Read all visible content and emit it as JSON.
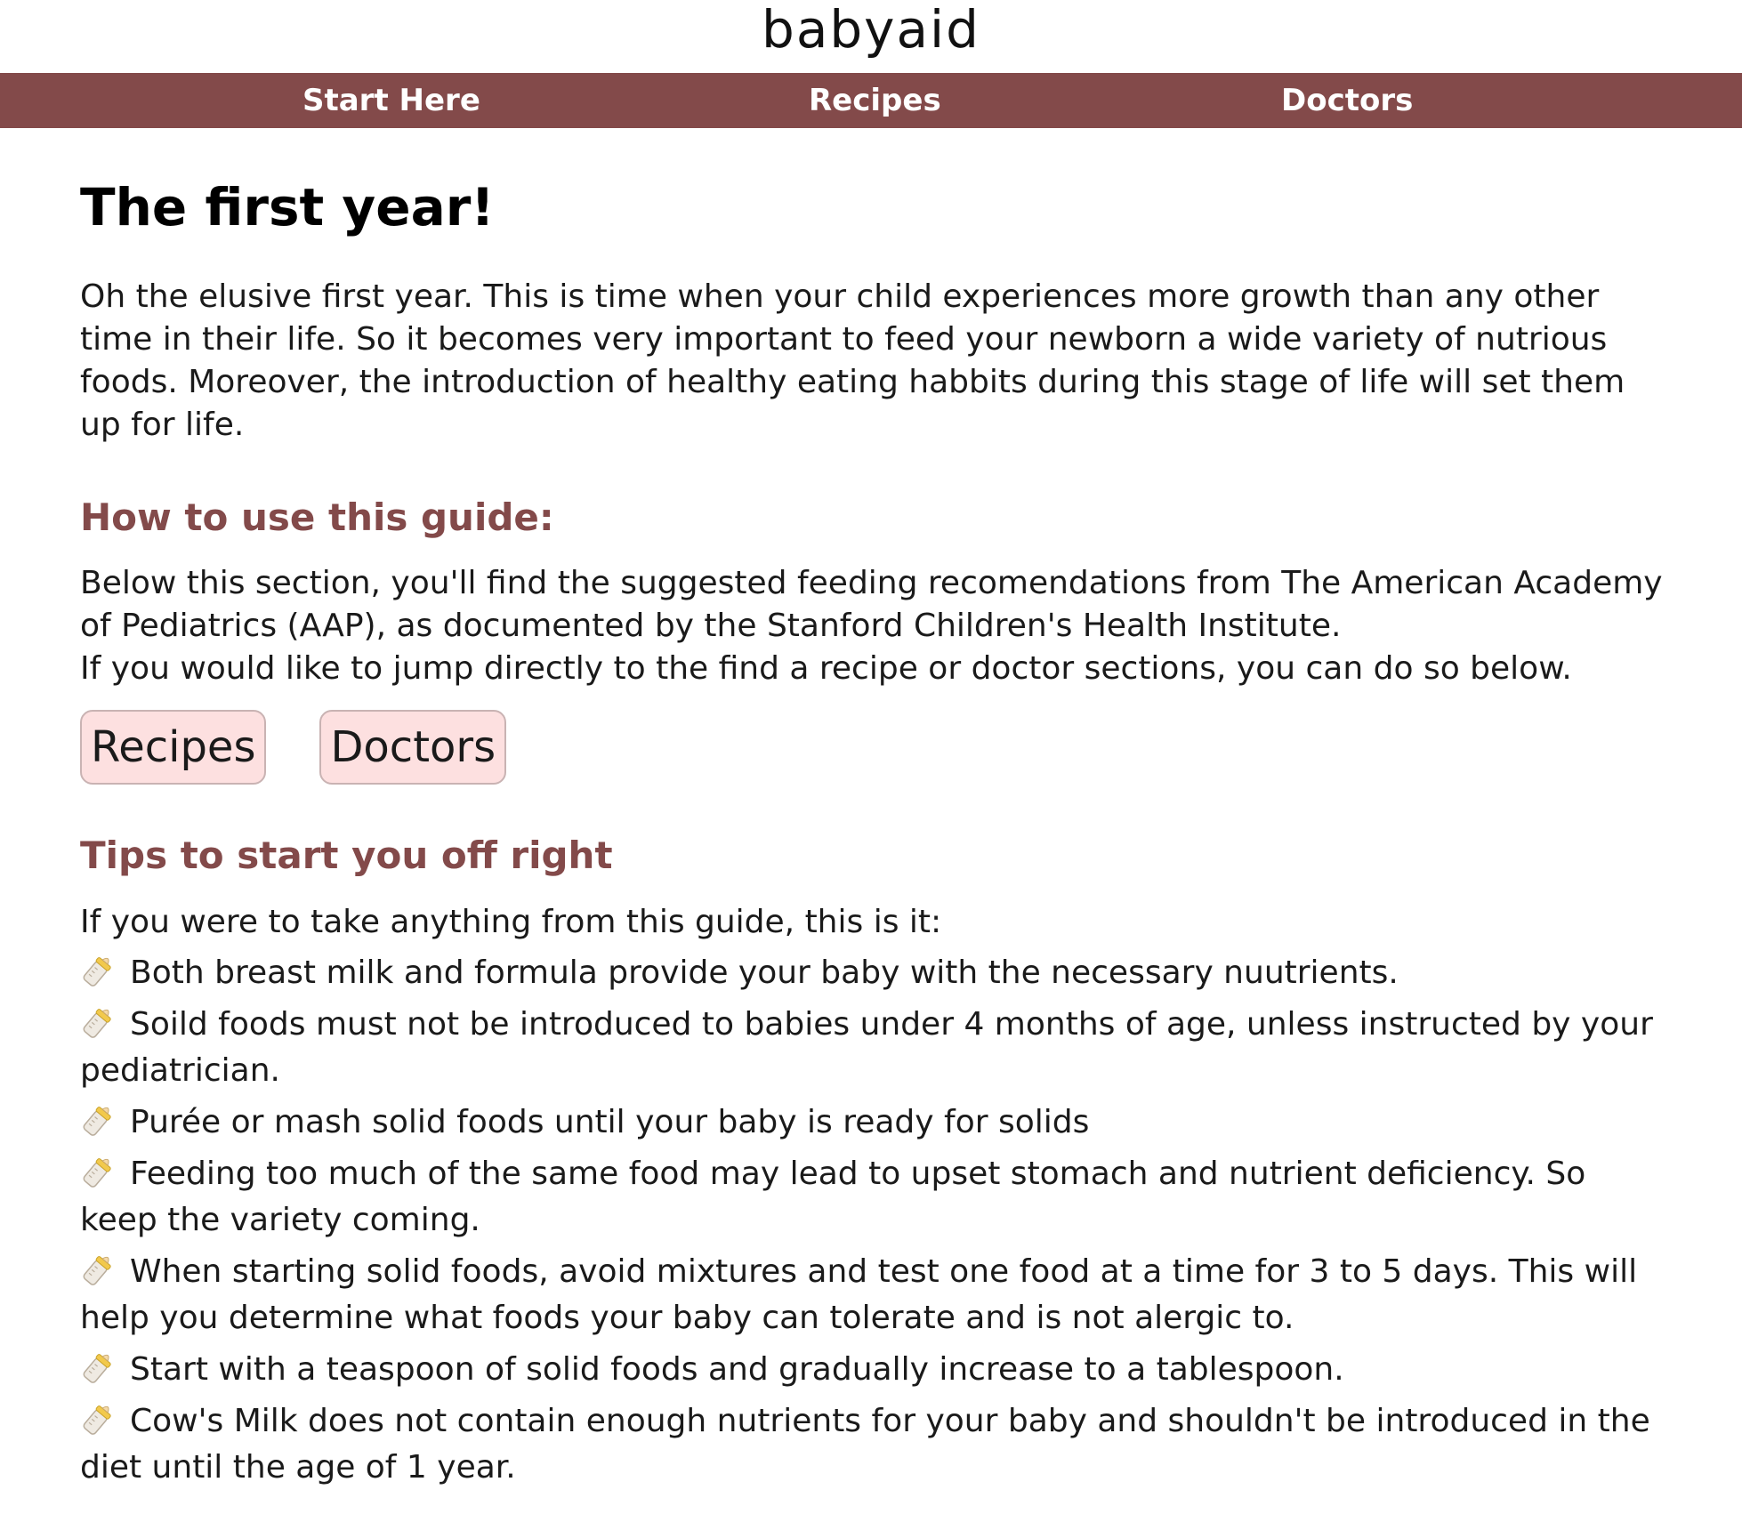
{
  "brand": {
    "logo_text": "babyaid"
  },
  "nav": {
    "items": [
      {
        "label": "Start Here"
      },
      {
        "label": "Recipes"
      },
      {
        "label": "Doctors"
      }
    ]
  },
  "main": {
    "title": "The first year!",
    "intro": "Oh the elusive first year. This is time when your child experiences more growth than any other time in their life. So it becomes very important to feed your newborn a wide variety of nutrious foods. Moreover, the introduction of healthy eating habbits during this stage of life will set them up for life.",
    "guide": {
      "heading": "How to use this guide:",
      "paragraph1": "Below this section, you'll find the suggested feeding recomendations from The American Academy of Pediatrics (AAP), as documented by the Stanford Children's Health Institute.",
      "paragraph2": "If you would like to jump directly to the find a recipe or doctor sections, you can do so below.",
      "buttons": [
        {
          "label": "Recipes"
        },
        {
          "label": "Doctors"
        }
      ]
    },
    "tips": {
      "heading": "Tips to start you off right",
      "intro": "If you were to take anything from this guide, this is it:",
      "bullet_icon": "baby-bottle-icon",
      "items": [
        "Both breast milk and formula provide your baby with the necessary nuutrients.",
        "Soild foods must not be introduced to babies under 4 months of age, unless instructed by your pediatrician.",
        "Purée or mash solid foods until your baby is ready for solids",
        "Feeding too much of the same food may lead to upset stomach and nutrient deficiency. So keep the variety coming.",
        "When starting solid foods, avoid mixtures and test one food at a time for 3 to 5 days. This will help you determine what foods your baby can tolerate and is not alergic to.",
        "Start with a teaspoon of solid foods and gradually increase to a tablespoon.",
        "Cow's Milk does not contain enough nutrients for your baby and shouldn't be introduced in the diet until the age of 1 year."
      ]
    }
  },
  "colors": {
    "accent": "#834a4a",
    "button_bg": "#fde0e0",
    "nav_text": "#ffffff"
  }
}
